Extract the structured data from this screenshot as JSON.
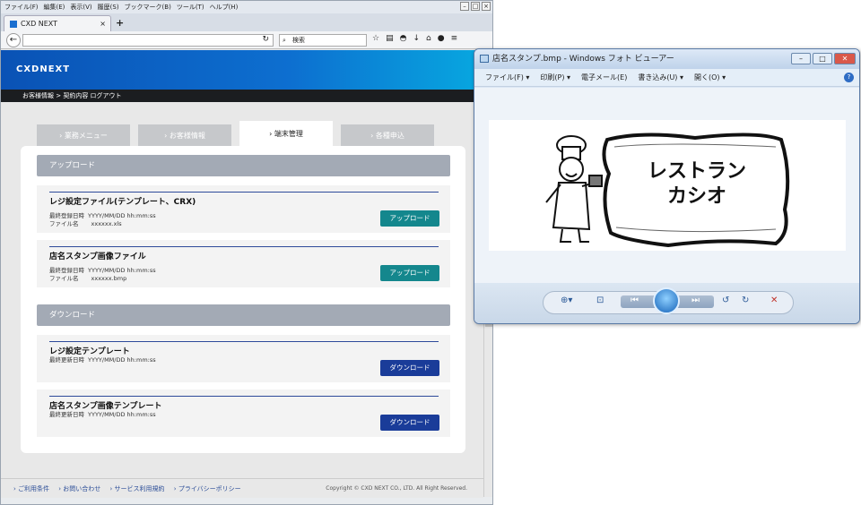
{
  "browser": {
    "menu": [
      "ファイル(F)",
      "編集(E)",
      "表示(V)",
      "履歴(S)",
      "ブックマーク(B)",
      "ツール(T)",
      "ヘルプ(H)"
    ],
    "tab_title": "CXD NEXT",
    "new_tab": "+",
    "search_placeholder": "検索"
  },
  "site": {
    "logo": "CXDNEXT",
    "breadcrumb": "お客様情報 > 契約内容  ログアウト",
    "tabs": [
      "› 業務メニュー",
      "› お客様情報",
      "› 端末管理",
      "› 各種申込"
    ],
    "upload_section": "アップロード",
    "download_section": "ダウンロード",
    "cards": [
      {
        "title": "レジ設定ファイル(テンプレート、CRX)",
        "l1": "最終登録日時",
        "v1": "YYYY/MM/DD hh:mm:ss",
        "l2": "ファイル名",
        "v2": "xxxxxx.xls",
        "button": "アップロード"
      },
      {
        "title": "店名スタンプ画像ファイル",
        "l1": "最終登録日時",
        "v1": "YYYY/MM/DD hh:mm:ss",
        "l2": "ファイル名",
        "v2": "xxxxxx.bmp",
        "button": "アップロード"
      },
      {
        "title": "レジ設定テンプレート",
        "l1": "最終更新日時",
        "v1": "YYYY/MM/DD hh:mm:ss",
        "l2": "",
        "v2": "",
        "button": "ダウンロード"
      },
      {
        "title": "店名スタンプ画像テンプレート",
        "l1": "最終更新日時",
        "v1": "YYYY/MM/DD hh:mm:ss",
        "l2": "",
        "v2": "",
        "button": "ダウンロード"
      }
    ],
    "footer": [
      "› ご利用条件",
      "› お問い合わせ",
      "› サービス利用規約",
      "› プライバシーポリシー"
    ],
    "copyright": "Copyright © CXD NEXT CO., LTD. All Right Reserved."
  },
  "viewer": {
    "title": "店名スタンプ.bmp - Windows フォト ビューアー",
    "menu": [
      "ファイル(F) ▾",
      "印刷(P) ▾",
      "電子メール(E)",
      "書き込み(U) ▾",
      "開く(O) ▾"
    ],
    "stamp_line1": "レストラン",
    "stamp_line2": "カシオ"
  }
}
